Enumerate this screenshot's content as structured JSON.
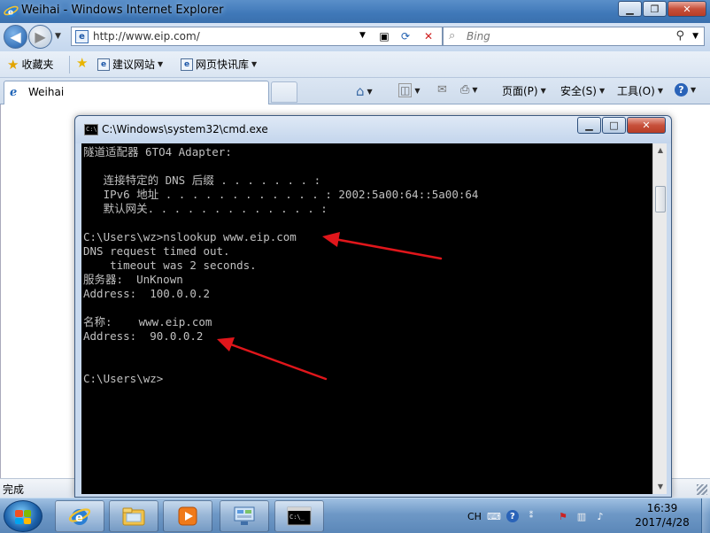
{
  "ie": {
    "title": "Weihai - Windows Internet Explorer",
    "address": "http://www.eip.com/",
    "search_placeholder": "Bing",
    "favorites": {
      "label": "收藏夹",
      "suggested_sites": "建议网站",
      "web_slice_gallery": "网页快讯库"
    },
    "tab_title": "Weihai",
    "commands": {
      "page": "页面(P)",
      "safety": "安全(S)",
      "tools": "工具(O)"
    },
    "status": "完成"
  },
  "cmd": {
    "title": "C:\\Windows\\system32\\cmd.exe",
    "lines": [
      "隧道适配器 6TO4 Adapter:",
      "",
      "   连接特定的 DNS 后缀 . . . . . . . :",
      "   IPv6 地址 . . . . . . . . . . . . : 2002:5a00:64::5a00:64",
      "   默认网关. . . . . . . . . . . . . :",
      "",
      "C:\\Users\\wz>nslookup www.eip.com",
      "DNS request timed out.",
      "    timeout was 2 seconds.",
      "服务器:  UnKnown",
      "Address:  100.0.0.2",
      "",
      "名称:    www.eip.com",
      "Address:  90.0.0.2",
      "",
      "",
      "C:\\Users\\wz>"
    ]
  },
  "taskbar": {
    "language": "CH",
    "time": "16:39",
    "date": "2017/4/28"
  },
  "colors": {
    "annotation_arrow": "#e0161b",
    "console_bg": "#000000",
    "console_text": "#c0c0c0"
  }
}
